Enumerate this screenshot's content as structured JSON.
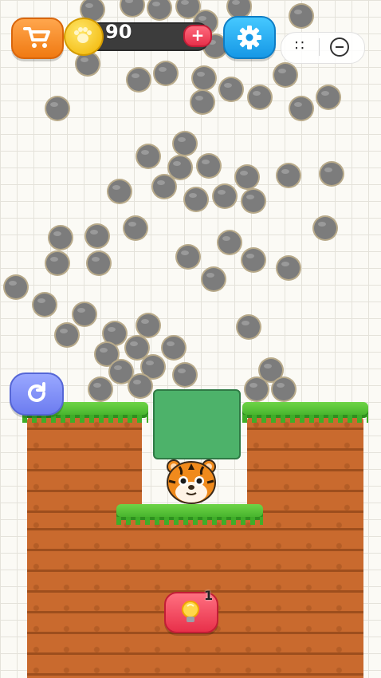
{
  "hud": {
    "coins": "90",
    "add_coins_label": "+",
    "menu_dots": "∷"
  },
  "level": {
    "hint_count": "1"
  },
  "colors": {
    "ball": "#7c7c7c",
    "ball_rim": "#b8aa8a",
    "grass": "#5cc63a",
    "dirt": "#c96a2e",
    "block": "#4db26a",
    "tiger": "#f08a1c"
  },
  "icons": {
    "shop": "cart-icon",
    "coin": "paw-coin-icon",
    "settings": "gear-icon",
    "restart": "restart-icon",
    "hint": "lightbulb-icon",
    "minimize": "minimize-icon"
  }
}
